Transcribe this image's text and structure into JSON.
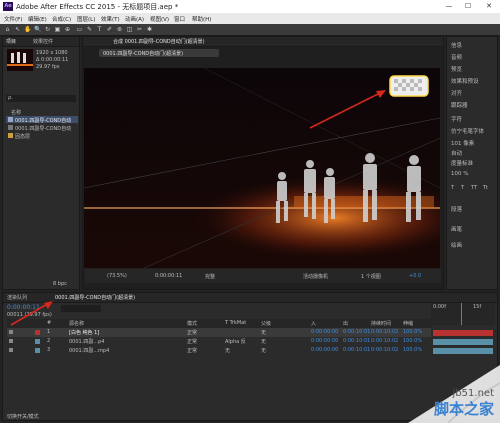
{
  "window": {
    "title": "Adobe After Effects CC 2015 - 无标题项目.aep *",
    "logo_text": "Ae",
    "minimize": "—",
    "maximize": "☐",
    "close": "✕"
  },
  "menu": [
    "文件(F)",
    "编辑(E)",
    "合成(C)",
    "图层(L)",
    "效果(T)",
    "动画(A)",
    "视图(V)",
    "窗口",
    "帮助(H)"
  ],
  "toolbar": {
    "icons": [
      "home-icon",
      "selection-tool-icon",
      "hand-tool-icon",
      "zoom-tool-icon",
      "rotate-tool-icon",
      "camera-tool-icon",
      "pan-behind-icon",
      "rectangle-tool-icon",
      "pen-tool-icon",
      "text-tool-icon",
      "brush-tool-icon",
      "clone-stamp-icon",
      "eraser-icon",
      "roto-brush-icon",
      "puppet-pin-icon"
    ],
    "glyphs": [
      "⌂",
      "↖",
      "✋",
      "🔍",
      "↻",
      "▣",
      "⊕",
      "▭",
      "✎",
      "T",
      "✐",
      "⊛",
      "◫",
      "✂",
      "✱"
    ]
  },
  "project_panel": {
    "tab_label": "项目",
    "effect_controls_tab": "效果控件",
    "thumb_info": [
      "1920 x 1080",
      "Δ 0:00:00:11",
      "29.97 fps"
    ],
    "search_placeholder": "ρ.",
    "column_name": "名称",
    "items": [
      {
        "name": "0001.四副导-COND自动",
        "icon": "comp-icon"
      },
      {
        "name": "0001.四副导-COND自动",
        "icon": "footage-icon"
      },
      {
        "name": "固态层",
        "icon": "folder-icon"
      }
    ],
    "bottom_label": "8 bpc"
  },
  "composition_panel": {
    "tab_label": "合成 0001.四副导-COND自动门(超清景)",
    "breadcrumb": "0001.四副导-COND自动门(超清景)",
    "zoom": "(73.5%)",
    "timecode": "0:00:00:11",
    "resolution": "完整",
    "camera": "活动摄像机",
    "views": "1 个视图",
    "exposure": "+0.0"
  },
  "right_panel": {
    "items": [
      "信息",
      "音频",
      "预览",
      "效果和预设",
      "对齐",
      "跟踪器",
      "字体",
      "段落",
      "画笔",
      "绘画"
    ],
    "character_header": "字符",
    "font_name": "仿宁毛笔字体",
    "font_size": "101 像素",
    "leading": "自动",
    "tracking": "度量标准",
    "scale": "100 %",
    "style_buttons": [
      "T",
      "T",
      "TT",
      "Tt"
    ]
  },
  "timeline": {
    "tabs": [
      "渲染队列",
      "0001.四副导-COND自动门(超清景)"
    ],
    "current_time": "0:00:00:11",
    "frame_info": "00011 (29.97 fps)",
    "columns": [
      "#",
      "源名称",
      "模式",
      "T TrkMat",
      "父级",
      "入",
      "出",
      "持续时间",
      "伸缩"
    ],
    "layers": [
      {
        "num": "1",
        "name": "[白色 纯色 1]",
        "mode": "正常",
        "trkmat": "",
        "parent": "无",
        "in": "0:00:00:00",
        "out": "0:00:10:01",
        "duration": "0:00:10:02",
        "stretch": "100.0%",
        "color": "#b83232",
        "selected": true
      },
      {
        "num": "2",
        "name": "0001.四副...p4",
        "mode": "正常",
        "trkmat": "Alpha 反",
        "parent": "无",
        "in": "0:00:00:00",
        "out": "0:00:10:01",
        "duration": "0:00:10:02",
        "stretch": "100.0%",
        "color": "#5a8fa8",
        "selected": false
      },
      {
        "num": "3",
        "name": "0001.四副...mp4",
        "mode": "正常",
        "trkmat": "无",
        "parent": "无",
        "in": "0:00:00:00",
        "out": "0:00:10:01",
        "duration": "0:00:10:02",
        "stretch": "100.0%",
        "color": "#5a8fa8",
        "selected": false
      }
    ],
    "ruler_labels": [
      "0:00f",
      "15f"
    ],
    "footer": "切换开关/模式"
  },
  "watermark": {
    "site": "jb51.net",
    "name": "脚本之家"
  },
  "colors": {
    "accent_blue": "#2d8ceb",
    "annotation_red": "#d8281c",
    "layer_red": "#b83232",
    "layer_teal": "#5a8fa8"
  }
}
